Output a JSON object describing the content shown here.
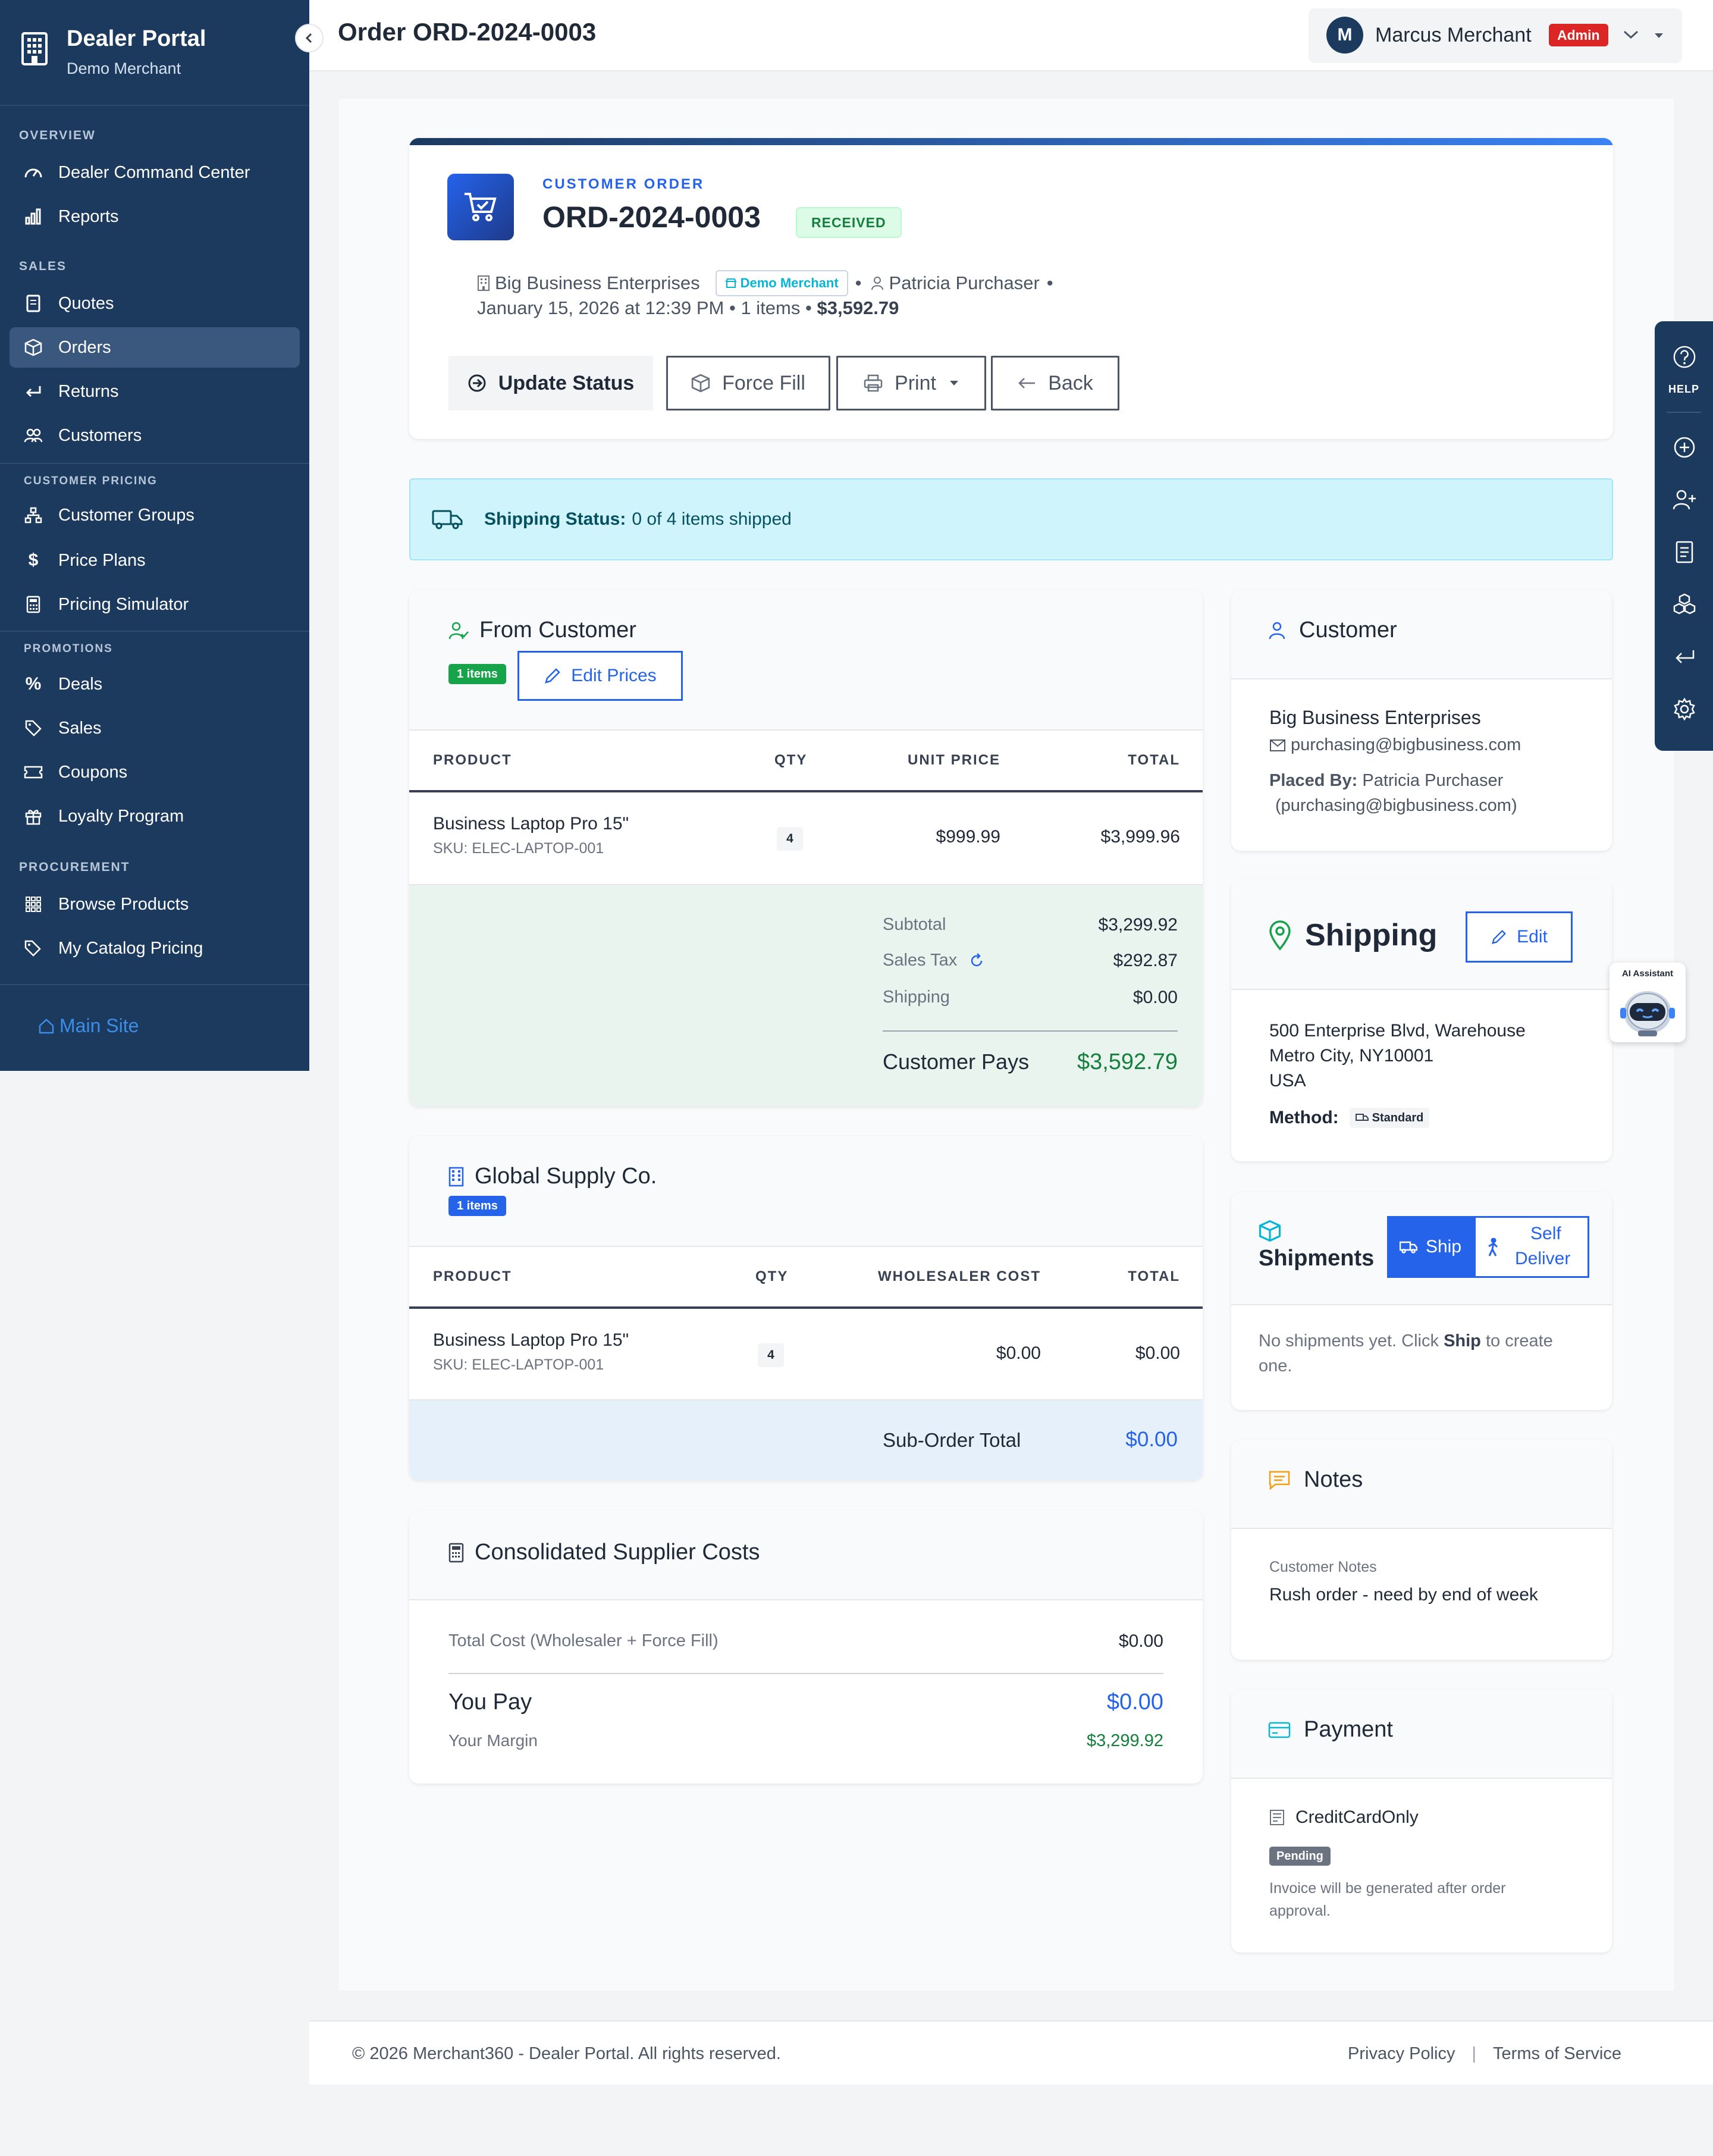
{
  "sidebar": {
    "brand_title": "Dealer Portal",
    "brand_sub": "Demo Merchant",
    "sections": {
      "overview": "OVERVIEW",
      "sales": "SALES",
      "customer_pricing": "CUSTOMER PRICING",
      "promotions": "PROMOTIONS",
      "procurement": "PROCUREMENT"
    },
    "items": {
      "dashboard": "Dealer Command Center",
      "reports": "Reports",
      "quotes": "Quotes",
      "orders": "Orders",
      "returns": "Returns",
      "customers": "Customers",
      "customer_groups": "Customer Groups",
      "price_plans": "Price Plans",
      "pricing_simulator": "Pricing Simulator",
      "deals": "Deals",
      "sales": "Sales",
      "coupons": "Coupons",
      "loyalty": "Loyalty Program",
      "browse": "Browse Products",
      "catalog_pricing": "My Catalog Pricing"
    },
    "active_item": "Orders",
    "main_site": "Main Site"
  },
  "topbar": {
    "title": "Order ORD-2024-0003",
    "user_initial": "M",
    "user_name": "Marcus Merchant",
    "role_badge": "Admin"
  },
  "order": {
    "type_label": "CUSTOMER ORDER",
    "number": "ORD-2024-0003",
    "status": "RECEIVED",
    "customer": "Big Business Enterprises",
    "merchant_badge": "Demo Merchant",
    "purchaser": "Patricia Purchaser",
    "bullet": "•",
    "date": "January 15, 2026 at 12:39 PM",
    "items_count": "1 items",
    "total": "$3,592.79",
    "actions": {
      "update_status": "Update Status",
      "force_fill": "Force Fill",
      "print": "Print",
      "back": "Back"
    }
  },
  "shipping_status": {
    "label": "Shipping Status:",
    "text": "0 of 4 items shipped"
  },
  "from_customer": {
    "title": "From Customer",
    "items_badge": "1 items",
    "edit_prices": "Edit Prices",
    "columns": [
      "PRODUCT",
      "QTY",
      "UNIT PRICE",
      "TOTAL"
    ],
    "rows": [
      {
        "product": "Business Laptop Pro 15\"",
        "sku": "SKU: ELEC-LAPTOP-001",
        "qty": "4",
        "unit_price": "$999.99",
        "total": "$3,999.96"
      }
    ],
    "summary": {
      "subtotal_label": "Subtotal",
      "subtotal": "$3,299.92",
      "tax_label": "Sales Tax",
      "tax": "$292.87",
      "shipping_label": "Shipping",
      "shipping": "$0.00",
      "pays_label": "Customer Pays",
      "pays": "$3,592.79"
    }
  },
  "supplier": {
    "title": "Global Supply Co.",
    "items_badge": "1 items",
    "columns": [
      "PRODUCT",
      "QTY",
      "WHOLESALER COST",
      "TOTAL"
    ],
    "rows": [
      {
        "product": "Business Laptop Pro 15\"",
        "sku": "SKU: ELEC-LAPTOP-001",
        "qty": "4",
        "cost": "$0.00",
        "total": "$0.00"
      }
    ],
    "sub_total_label": "Sub-Order Total",
    "sub_total": "$0.00"
  },
  "consolidated": {
    "title": "Consolidated Supplier Costs",
    "total_cost_label": "Total Cost (Wholesaler + Force Fill)",
    "total_cost": "$0.00",
    "you_pay_label": "You Pay",
    "you_pay": "$0.00",
    "margin_label": "Your Margin",
    "margin": "$3,299.92"
  },
  "customer_panel": {
    "title": "Customer",
    "name": "Big Business Enterprises",
    "email": "purchasing@bigbusiness.com",
    "placed_by_label": "Placed By:",
    "placed_by": "Patricia Purchaser",
    "placed_by_email": "(purchasing@bigbusiness.com)"
  },
  "shipping_panel": {
    "title": "Shipping",
    "edit": "Edit",
    "line1": "500 Enterprise Blvd, Warehouse",
    "line2": "Metro City, NY10001",
    "line3": "USA",
    "method_label": "Method:",
    "method": "Standard"
  },
  "shipments_panel": {
    "title": "Shipments",
    "ship": "Ship",
    "self_deliver_1": "Self",
    "self_deliver_2": "Deliver",
    "empty_pre": "No shipments yet. Click",
    "empty_bold": "Ship",
    "empty_post": "to create",
    "empty_line2": "one."
  },
  "notes_panel": {
    "title": "Notes",
    "label": "Customer Notes",
    "text": "Rush order - need by end of week"
  },
  "payment_panel": {
    "title": "Payment",
    "method": "CreditCardOnly",
    "status": "Pending",
    "note_1": "Invoice will be generated after order",
    "note_2": "approval."
  },
  "right_rail": {
    "help": "HELP"
  },
  "ai_assistant": "AI Assistant",
  "footer": {
    "copyright": "© 2026 Merchant360 - Dealer Portal. All rights reserved.",
    "privacy": "Privacy Policy",
    "separator": "|",
    "terms": "Terms of Service"
  },
  "colors": {
    "sidebar": "#1c3a5e",
    "accent": "#2563eb",
    "success": "#15803d",
    "danger": "#dc2626",
    "info_bg": "#cff4fc"
  }
}
